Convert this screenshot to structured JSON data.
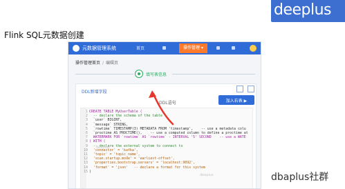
{
  "brand": "deeplus",
  "slide_title": "Flink SQL元数据创建",
  "footer": "dbaplus社群",
  "app": {
    "system_name": "元数据管理系统",
    "nav": [
      "首页",
      "",
      "操作管理 ▾",
      "",
      ""
    ],
    "breadcrumb": {
      "home": "操作管理首页",
      "separator": "/",
      "current": "编辑页"
    },
    "step_label": "填写表信息",
    "panel_title": "DDL新增字段",
    "panel_tab": "DDL语句",
    "add_button": "加入右表 ▶"
  },
  "code_lines": [
    {
      "n": "1",
      "text": "CREATE TABLE MyUserTable ("
    },
    {
      "n": "2",
      "text": "  -- declare the schema of the table"
    },
    {
      "n": "3",
      "text": "  `user` BIGINT,"
    },
    {
      "n": "4",
      "text": "  `message` STRING,"
    },
    {
      "n": "5",
      "text": "  `rowtime` TIMESTAMP(3) METADATA FROM 'timestamp',    -- use a metadata colu"
    },
    {
      "n": "6",
      "text": "  `proctime AS PROCTIME(),    -- use a computed column to define a proctime at"
    },
    {
      "n": "7",
      "text": "  WATERMARK FOR `rowtime` AS `rowtime` - INTERVAL '5' SECOND    -- use a WATE"
    },
    {
      "n": "8",
      "text": ") WITH ("
    },
    {
      "n": "9",
      "text": "  -- declare the external system to connect to"
    },
    {
      "n": "10",
      "text": "  'connector' = 'kafka',"
    },
    {
      "n": "11",
      "text": "  'topic' = 'topic_name',"
    },
    {
      "n": "12",
      "text": "  'scan.startup.mode' = 'earliest-offset',"
    },
    {
      "n": "13",
      "text": "  'properties.bootstrap.servers' = 'localhost:9092',"
    },
    {
      "n": "14",
      "text": "  'format' = 'json'   -- declare a format for this system"
    },
    {
      "n": "15",
      "text": ")"
    }
  ],
  "colors": {
    "accent": "#2f6cd8",
    "brand_bar": "#3d6fd1",
    "active_nav": "#ff7a2a",
    "step_green": "#27ae60",
    "arrow": "#e8362b"
  }
}
